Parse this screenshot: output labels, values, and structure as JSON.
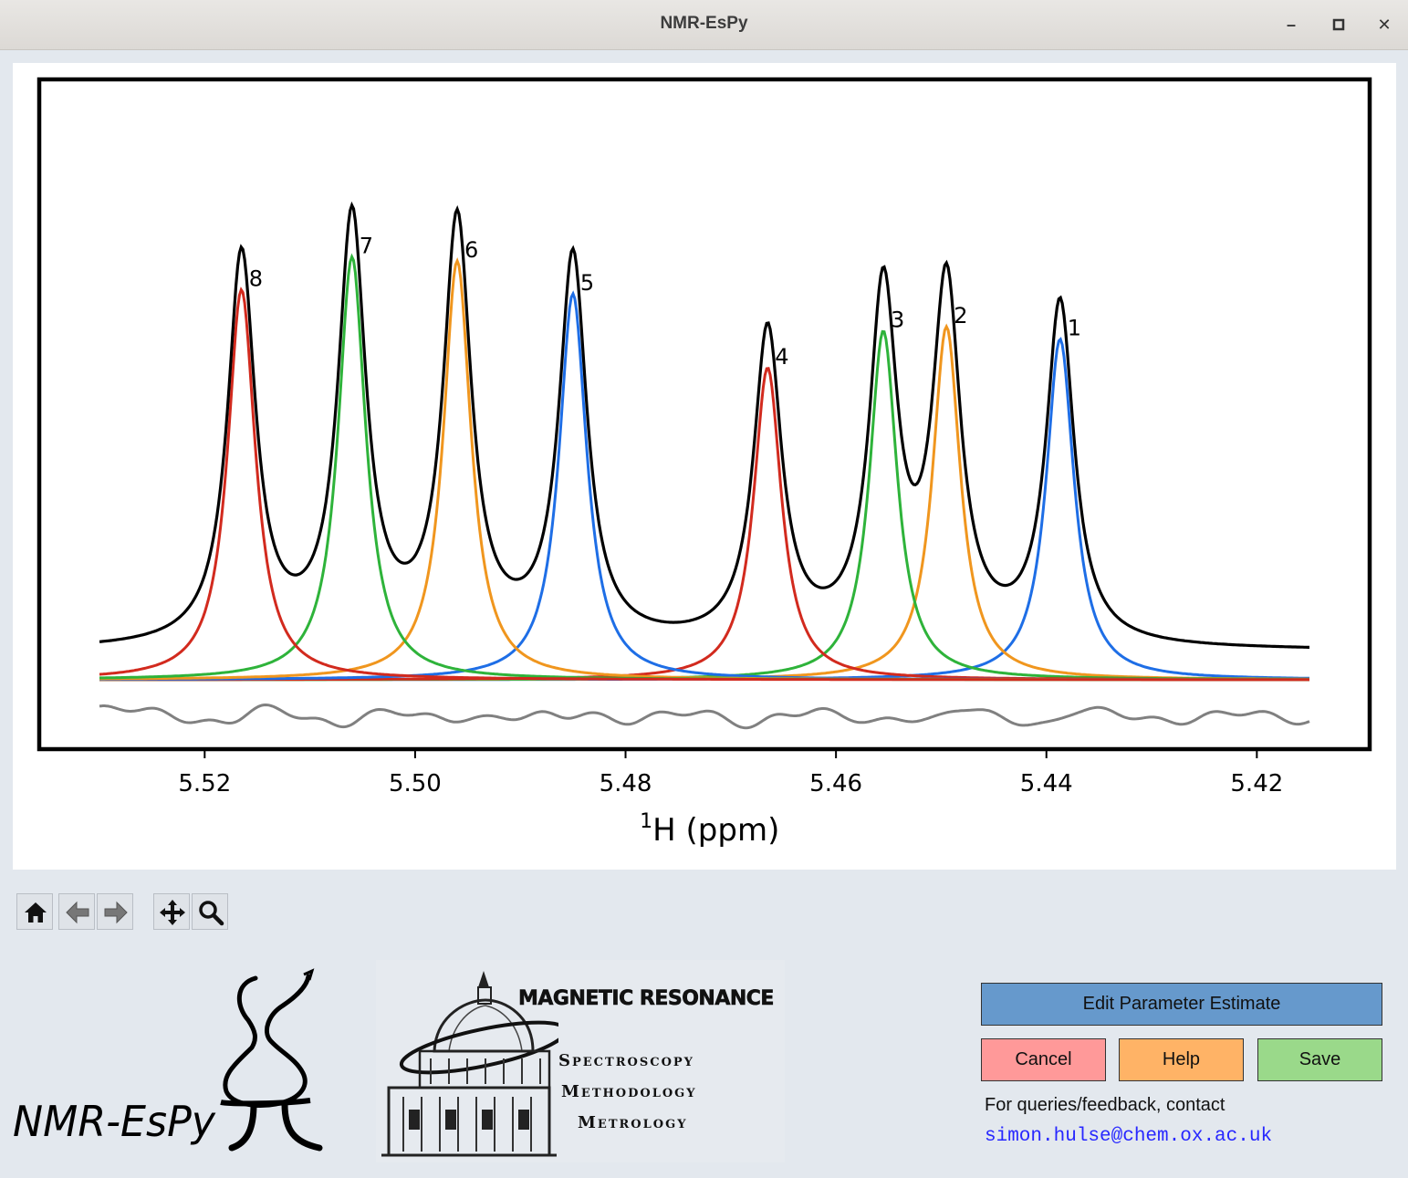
{
  "window": {
    "title": "NMR-EsPy",
    "minimize_icon": "minimize-icon",
    "maximize_icon": "maximize-icon",
    "close_icon": "close-icon"
  },
  "chart_data": {
    "type": "line",
    "xlabel_prefix": "1",
    "xlabel": "H (ppm)",
    "xlim": [
      5.53,
      5.415
    ],
    "x_reversed": true,
    "x_ticks": [
      "5.52",
      "5.50",
      "5.48",
      "5.46",
      "5.44",
      "5.42"
    ],
    "x_tick_values": [
      5.52,
      5.5,
      5.48,
      5.46,
      5.44,
      5.42
    ],
    "ylim": [
      -0.22,
      1.0
    ],
    "grid": false,
    "legend": "none",
    "colors": {
      "spectrum": "#000000",
      "residual": "#808080",
      "red": "#d22a1e",
      "green": "#2eb33a",
      "orange": "#f0961e",
      "blue": "#1e6ee6"
    },
    "oscillators": [
      {
        "label": "1",
        "position": 5.4387,
        "height": 0.83,
        "color": "blue"
      },
      {
        "label": "2",
        "position": 5.4495,
        "height": 0.86,
        "color": "orange"
      },
      {
        "label": "3",
        "position": 5.4555,
        "height": 0.85,
        "color": "green"
      },
      {
        "label": "4",
        "position": 5.4665,
        "height": 0.76,
        "color": "red"
      },
      {
        "label": "5",
        "position": 5.485,
        "height": 0.94,
        "color": "blue"
      },
      {
        "label": "6",
        "position": 5.496,
        "height": 1.02,
        "color": "orange"
      },
      {
        "label": "7",
        "position": 5.506,
        "height": 1.03,
        "color": "green"
      },
      {
        "label": "8",
        "position": 5.5165,
        "height": 0.95,
        "color": "red"
      }
    ],
    "linewidth_ppm": 0.0016,
    "spectrum_offset": 0.07,
    "residual_offset": -0.09
  },
  "toolbar": {
    "home": "home-icon",
    "back": "back-arrow-icon",
    "forward": "forward-arrow-icon",
    "pan": "pan-icon",
    "zoom": "zoom-icon"
  },
  "logos": {
    "nmr_espy_text": "NMR-EsPy",
    "mr_title": "MAGNETIC RESONANCE",
    "mr_line1": "Spectroscopy",
    "mr_line2": "Methodology",
    "mr_line3": "Metrology"
  },
  "buttons": {
    "edit": "Edit Parameter Estimate",
    "cancel": "Cancel",
    "help": "Help",
    "save": "Save"
  },
  "contact": {
    "label": "For queries/feedback, contact",
    "email": "simon.hulse@chem.ox.ac.uk"
  }
}
